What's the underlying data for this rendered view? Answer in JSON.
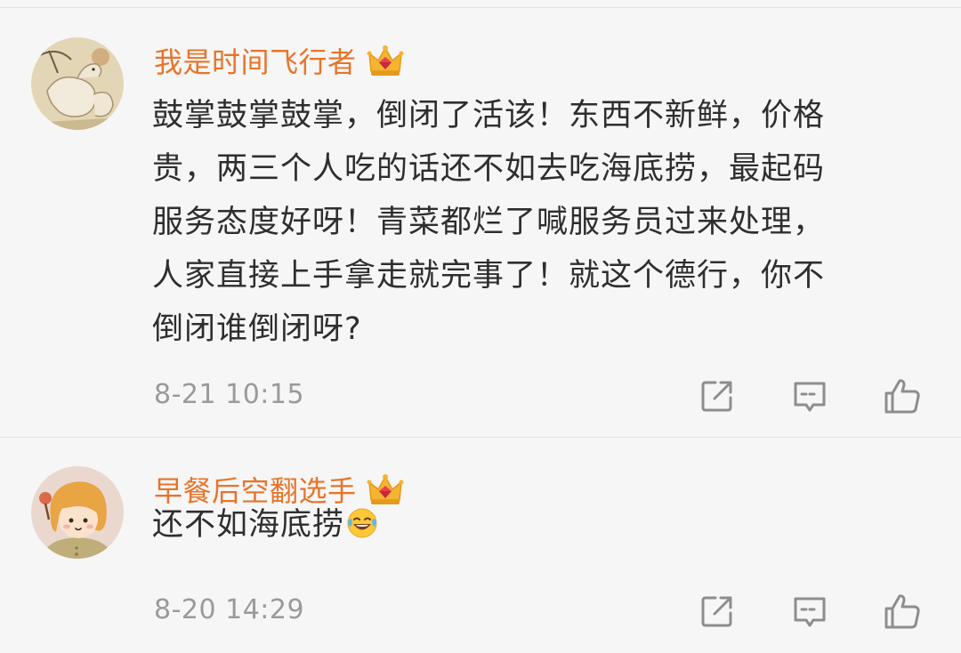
{
  "comments": [
    {
      "username": "我是时间飞行者",
      "badge_icon": "crown-member-icon",
      "lines": [
        "鼓掌鼓掌鼓掌，倒闭了活该！东西不新鲜，价格",
        "贵，两三个人吃的话还不如去吃海底捞，最起码",
        "服务态度好呀！青菜都烂了喊服务员过来处理，",
        "人家直接上手拿走就完事了！就这个德行，你不",
        "倒闭谁倒闭呀?"
      ],
      "timestamp": "8-21 10:15"
    },
    {
      "username": "早餐后空翻选手",
      "badge_icon": "crown-member-icon",
      "text": "还不如海底捞",
      "emoji": "laughing-tears-emoji",
      "timestamp": "8-20 14:29"
    }
  ],
  "actions": {
    "share_icon": "share-icon",
    "comment_icon": "comment-icon",
    "like_icon": "thumbs-up-icon"
  },
  "colors": {
    "username": "#e7742a",
    "text": "#2e2e2e",
    "meta": "#9a9a9a",
    "background": "#f6f6f6"
  }
}
